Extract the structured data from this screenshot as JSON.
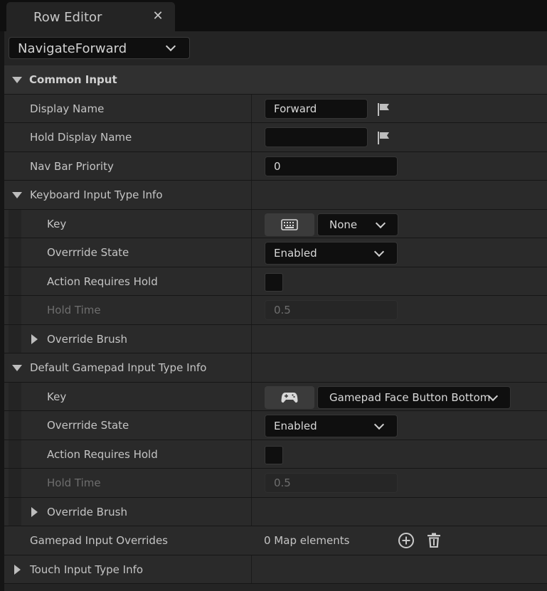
{
  "tab": {
    "title": "Row Editor",
    "close_glyph": "✕"
  },
  "row_selector": {
    "value": "NavigateForward"
  },
  "common_input": {
    "label": "Common Input",
    "display_name": {
      "label": "Display Name",
      "value": "Forward"
    },
    "hold_display_name": {
      "label": "Hold Display Name",
      "value": ""
    },
    "nav_bar_priority": {
      "label": "Nav Bar Priority",
      "value": "0"
    }
  },
  "keyboard": {
    "label": "Keyboard Input Type Info",
    "key": {
      "label": "Key",
      "icon": "keyboard-icon",
      "value": "None"
    },
    "override_state": {
      "label": "Overrride State",
      "value": "Enabled"
    },
    "action_requires_hold": {
      "label": "Action Requires Hold",
      "checked": false
    },
    "hold_time": {
      "label": "Hold Time",
      "value": "0.5"
    },
    "override_brush": {
      "label": "Override Brush"
    }
  },
  "gamepad": {
    "label": "Default Gamepad Input Type Info",
    "key": {
      "label": "Key",
      "icon": "gamepad-icon",
      "value": "Gamepad Face Button Bottom"
    },
    "override_state": {
      "label": "Overrride State",
      "value": "Enabled"
    },
    "action_requires_hold": {
      "label": "Action Requires Hold",
      "checked": false
    },
    "hold_time": {
      "label": "Hold Time",
      "value": "0.5"
    },
    "override_brush": {
      "label": "Override Brush"
    }
  },
  "gamepad_overrides": {
    "label": "Gamepad Input Overrides",
    "value": "0 Map elements"
  },
  "touch": {
    "label": "Touch Input Type Info"
  },
  "colors": {
    "panel": "#242424",
    "field": "#0f0f0f",
    "text": "#c4c4c4",
    "disabled_text": "#6e6e6e"
  }
}
